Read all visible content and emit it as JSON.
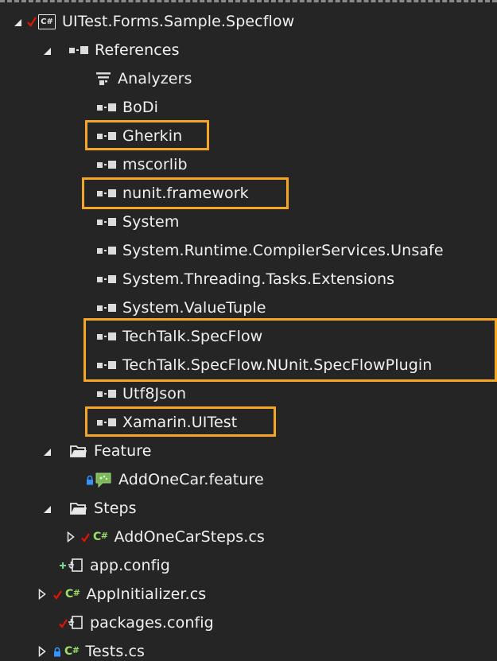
{
  "solution_tree": {
    "project": {
      "label": "UITest.Forms.Sample.Specflow",
      "icon_text": "C#"
    },
    "references": {
      "label": "References",
      "items": [
        {
          "label": "Analyzers"
        },
        {
          "label": "BoDi"
        },
        {
          "label": "Gherkin"
        },
        {
          "label": "mscorlib"
        },
        {
          "label": "nunit.framework"
        },
        {
          "label": "System"
        },
        {
          "label": "System.Runtime.CompilerServices.Unsafe"
        },
        {
          "label": "System.Threading.Tasks.Extensions"
        },
        {
          "label": "System.ValueTuple"
        },
        {
          "label": "TechTalk.SpecFlow"
        },
        {
          "label": "TechTalk.SpecFlow.NUnit.SpecFlowPlugin"
        },
        {
          "label": "Utf8Json"
        },
        {
          "label": "Xamarin.UITest"
        }
      ]
    },
    "feature_folder": {
      "label": "Feature",
      "file": {
        "label": "AddOneCar.feature"
      }
    },
    "steps_folder": {
      "label": "Steps",
      "file": {
        "label": "AddOneCarSteps.cs"
      }
    },
    "app_config": {
      "label": "app.config"
    },
    "app_initializer": {
      "label": "AppInitializer.cs"
    },
    "packages_config": {
      "label": "packages.config"
    },
    "tests": {
      "label": "Tests.cs"
    }
  },
  "icons": {
    "cs_icon_text": "C",
    "cs_icon_hash": "#",
    "check_mark": "✓",
    "lock_mark": "🔒"
  },
  "colors": {
    "background": "#252526",
    "text": "#f1f1f1",
    "highlight": "#f5a623",
    "check": "#e51400",
    "csharp": "#9ae067",
    "folder": "#e8e8e8"
  }
}
